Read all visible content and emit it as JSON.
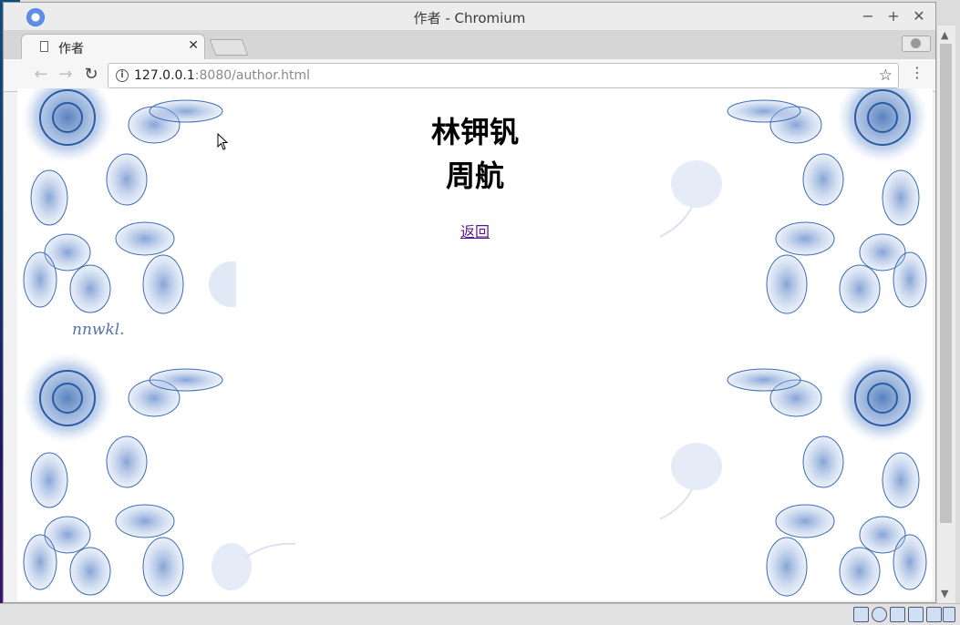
{
  "window": {
    "title": "作者 - Chromium",
    "controls": {
      "minimize": "−",
      "maximize": "+",
      "close": "✕"
    }
  },
  "tab": {
    "title": "作者",
    "close": "✕"
  },
  "toolbar": {
    "back": "←",
    "forward": "→",
    "reload": "↻",
    "url_host": "127.0.0.1",
    "url_path": ":8080/author.html",
    "info": "i",
    "bookmark": "☆",
    "menu": "⋮"
  },
  "page": {
    "authors": [
      "林钾钒",
      "周航"
    ],
    "back_link": "返回",
    "signature": "nnwkl."
  },
  "scrollbar": {
    "up": "▲",
    "down": "▼"
  },
  "colors": {
    "link_visited": "#551a8b",
    "floral": "#3b6cb3"
  }
}
